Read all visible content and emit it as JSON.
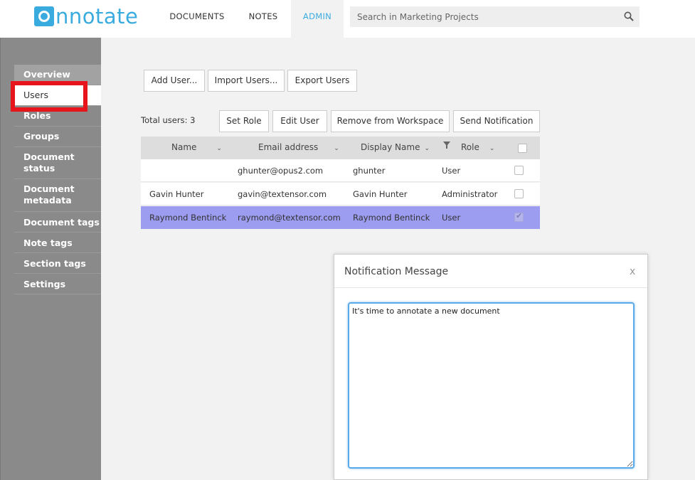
{
  "header": {
    "logo_rest": "nnotate",
    "tabs": [
      {
        "label": "DOCUMENTS",
        "active": false
      },
      {
        "label": "NOTES",
        "active": false
      },
      {
        "label": "ADMIN",
        "active": true
      }
    ],
    "search_placeholder": "Search in Marketing Projects"
  },
  "sidebar": {
    "items": [
      {
        "label": "Overview"
      },
      {
        "label": "Users",
        "active": true
      },
      {
        "label": "Roles"
      },
      {
        "label": "Groups"
      },
      {
        "label": "Document status"
      },
      {
        "label": "Document metadata"
      },
      {
        "label": "Document tags"
      },
      {
        "label": "Note tags"
      },
      {
        "label": "Section tags"
      },
      {
        "label": "Settings"
      }
    ]
  },
  "toolbar": {
    "add_users": "Add User...",
    "import_users": "Import Users...",
    "export_users": "Export Users",
    "total_users": "Total users: 3",
    "set_role": "Set Role",
    "edit_user": "Edit User",
    "remove_from_workspace": "Remove from Workspace",
    "send_notification": "Send Notification"
  },
  "table": {
    "columns": [
      "Name",
      "Email address",
      "Display Name",
      "Role"
    ],
    "rows": [
      {
        "name": "",
        "email": "ghunter@opus2.com",
        "display_name": "ghunter",
        "role": "User",
        "checked": false,
        "selected": false
      },
      {
        "name": "Gavin Hunter",
        "email": "gavin@textensor.com",
        "display_name": "Gavin Hunter",
        "role": "Administrator",
        "checked": false,
        "selected": false
      },
      {
        "name": "Raymond Bentinck",
        "email": "raymond@textensor.com",
        "display_name": "Raymond Bentinck",
        "role": "User",
        "checked": true,
        "selected": true
      }
    ]
  },
  "modal": {
    "title": "Notification Message",
    "close_label": "x",
    "message": "It's time to annotate a new document"
  },
  "colors": {
    "brand": "#3aabdf",
    "selected_row": "#9c9cf0",
    "highlight": "#e8141c"
  }
}
